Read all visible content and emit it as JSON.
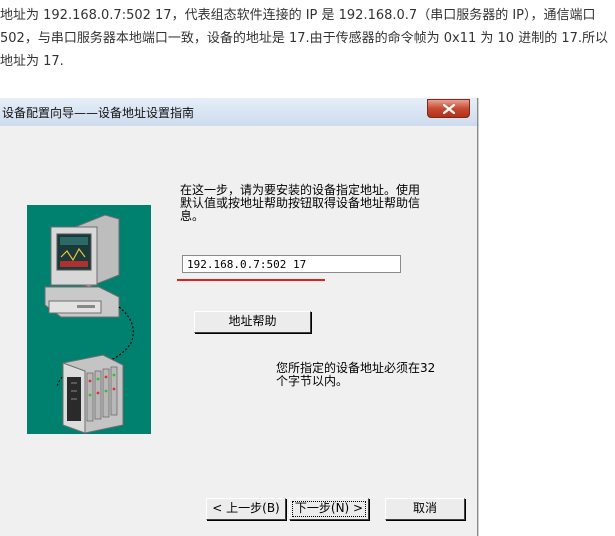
{
  "article": {
    "paragraph": "地址为 192.168.0.7:502 17，代表组态软件连接的 IP 是 192.168.0.7（串口服务器的 IP），通信端口 502，与串口服务器本地端口一致，设备的地址是 17.由于传感器的命令帧为 0x11 为 10 进制的 17.所以地址为 17."
  },
  "dialog": {
    "title": "设备配置向导——设备地址设置指南",
    "instructions": "在这一步，请为要安装的设备指定地址。使用默认值或按地址帮助按钮取得设备地址帮助信息。",
    "address_value": "192.168.0.7:502 17",
    "help_button_label": "地址帮助",
    "note": "您所指定的设备地址必须在32个字节以内。",
    "back_button_label": "< 上一步(B)",
    "next_button_label": "下一步(N) >",
    "cancel_button_label": "取消"
  },
  "icons": {
    "close": "close-icon",
    "computer": "computer-icon",
    "device": "device-rack-icon"
  },
  "colors": {
    "illustration_bg": "#00806f",
    "highlight_underline": "#e02020",
    "close_button": "#c84a32"
  }
}
